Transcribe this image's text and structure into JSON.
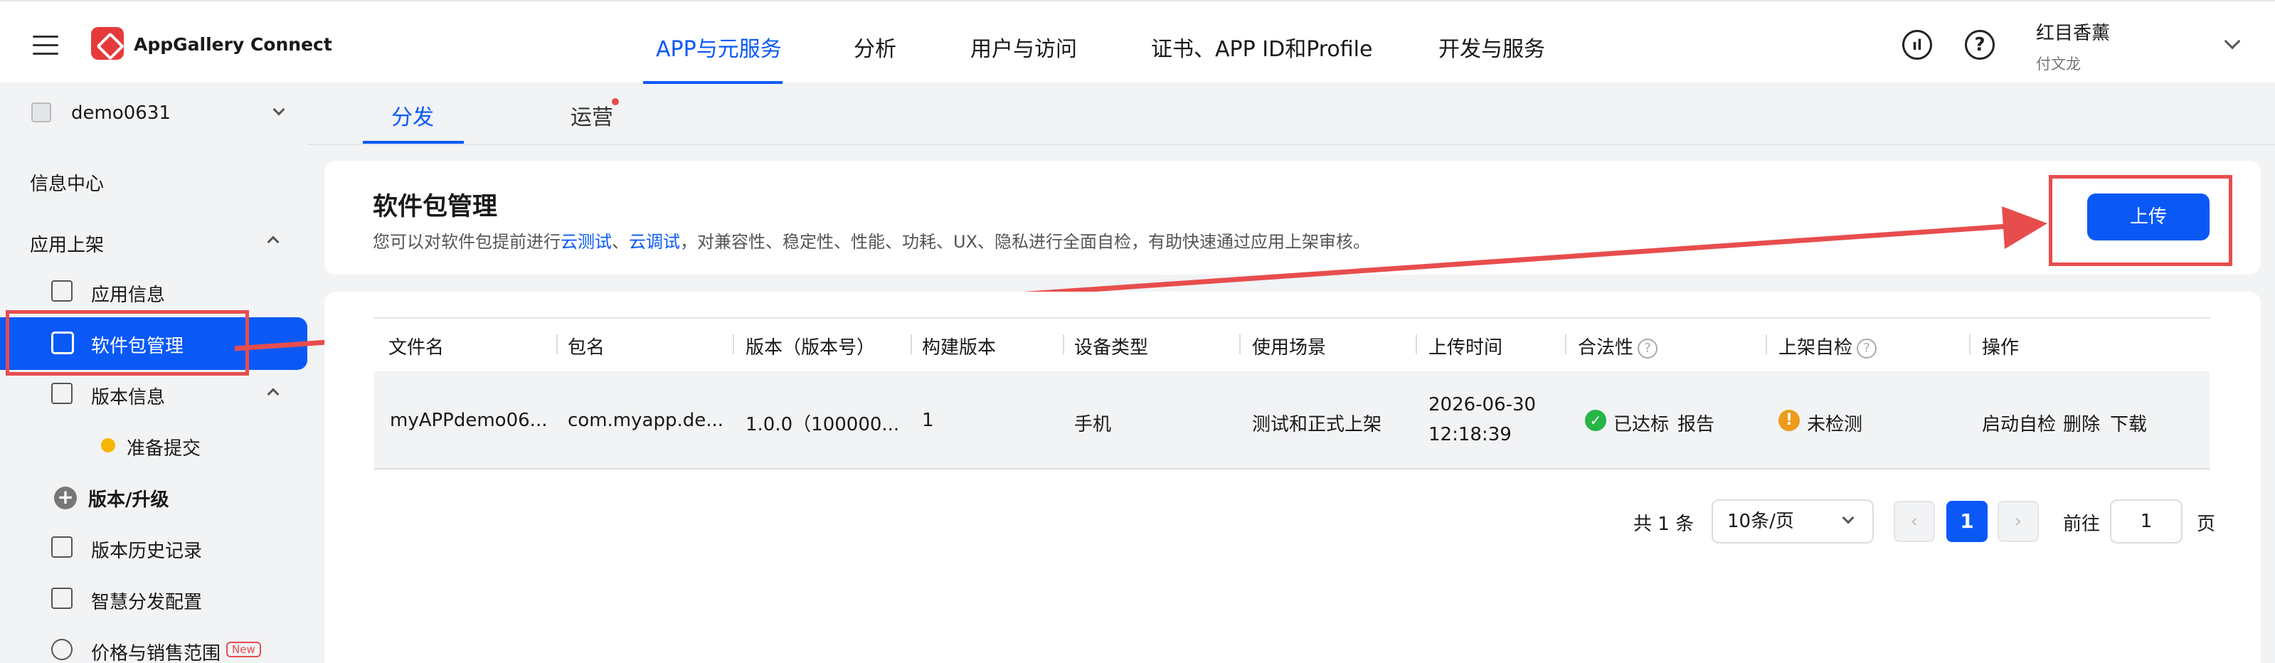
{
  "header": {
    "brand": "AppGallery Connect",
    "nav": [
      "APP与元服务",
      "分析",
      "用户与访问",
      "证书、APP ID和Profile",
      "开发与服务"
    ],
    "user_name": "红目香薰",
    "user_sub": "付文龙",
    "help_glyph": "?",
    "accent_color": "#0a59f7"
  },
  "sidebar": {
    "project": "demo0631",
    "info_center": "信息中心",
    "app_listing": "应用上架",
    "app_info": "应用信息",
    "package_mgmt": "软件包管理",
    "version_info": "版本信息",
    "ready_submit": "准备提交",
    "version_upgrade": "版本/升级",
    "version_history": "版本历史记录",
    "smart_dist": "智慧分发配置",
    "price_range": "价格与销售范围",
    "new_badge": "New"
  },
  "tabs": [
    "分发",
    "运营"
  ],
  "package": {
    "title": "软件包管理",
    "desc_prefix": "您可以对软件包提前进行",
    "link1": "云测试",
    "sep": "、",
    "link2": "云调试",
    "desc_suffix": "，对兼容性、稳定性、性能、功耗、UX、隐私进行全面自检，有助快速通过应用上架审核。",
    "upload": "上传"
  },
  "table": {
    "headers": [
      "文件名",
      "包名",
      "版本（版本号）",
      "构建版本",
      "设备类型",
      "使用场景",
      "上传时间",
      "合法性",
      "上架自检",
      "操作"
    ],
    "row": {
      "file": "myAPPdemo06...",
      "package": "com.myapp.de...",
      "version": "1.0.0（100000...",
      "build": "1",
      "device": "手机",
      "scene": "测试和正式上架",
      "date": "2026-06-30",
      "time": "12:18:39",
      "legal": "已达标",
      "report": "报告",
      "selfcheck": "未检测",
      "actions": [
        "启动自检",
        "删除",
        "下载"
      ]
    }
  },
  "pagination": {
    "total": "共 1 条",
    "page_size": "10条/页",
    "current": "1",
    "goto_label": "前往",
    "goto_value": "1",
    "page_label": "页"
  }
}
